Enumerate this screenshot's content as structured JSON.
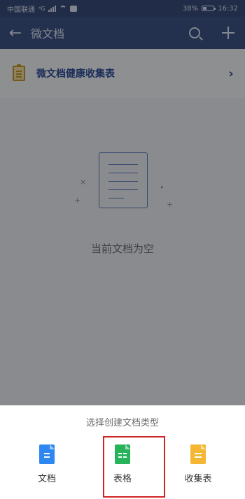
{
  "status_bar": {
    "carrier": "中国联通",
    "network": "⁴G",
    "battery": "38%",
    "battery_level": 0.38,
    "time": "16:32"
  },
  "app_bar": {
    "title": "微文档",
    "back_icon": "back-arrow-icon",
    "search_icon": "search-icon",
    "add_icon": "plus-icon"
  },
  "banner": {
    "text": "微文档健康收集表",
    "icon": "clipboard-icon"
  },
  "empty_state": {
    "text": "当前文档为空",
    "icon": "document-icon"
  },
  "sheet": {
    "title": "选择创建文档类型",
    "options": [
      {
        "label": "文档",
        "color": "#2e86f0",
        "icon": "doc-file-icon"
      },
      {
        "label": "表格",
        "color": "#27b35a",
        "icon": "sheet-file-icon"
      },
      {
        "label": "收集表",
        "color": "#f3b734",
        "icon": "form-file-icon"
      }
    ]
  },
  "colors": {
    "appbar": "#3d5387",
    "accent": "#2f4f9a",
    "highlight_box": "#cf2525"
  }
}
